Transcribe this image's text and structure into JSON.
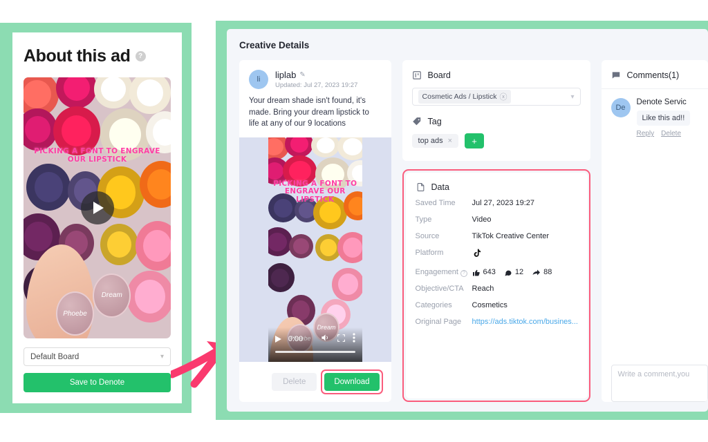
{
  "left_card": {
    "title": "About this ad",
    "help_icon": "question-mark-icon",
    "ad_image": {
      "overlay_text": "PICKING A FONT TO ENGRAVE OUR LIPSTICK",
      "disc_left_label": "Phoebe",
      "disc_right_label": "Dream",
      "play_icon": "play-icon"
    },
    "board_select": {
      "value": "Default Board",
      "caret": "⌄"
    },
    "save_button": "Save to Denote"
  },
  "right_panel": {
    "title": "Creative Details",
    "creative": {
      "avatar_initials": "li",
      "author": "liplab",
      "edit_icon": "pencil-icon",
      "updated": "Updated: Jul 27, 2023 19:27",
      "ad_copy": "Your dream shade isn't found, it's made. Bring your dream lipstick to life at any of our 9 locations",
      "video": {
        "overlay_text": "PICKING A FONT TO ENGRAVE OUR LIPSTICK",
        "disc_left_label": "Phoebe",
        "disc_right_label": "Dream",
        "play_icon": "play-icon",
        "current_time": "0:00",
        "volume_icon": "volume-icon",
        "fullscreen_icon": "fullscreen-icon",
        "more_icon": "kebab-menu-icon"
      },
      "delete_button": "Delete",
      "download_button": "Download"
    },
    "board": {
      "icon": "board-icon",
      "heading": "Board",
      "selected_value": "Cosmetic Ads / Lipstick",
      "remove_icon": "remove-circle-icon",
      "caret": "⌄",
      "tag_icon": "tag-icon",
      "tag_heading": "Tag",
      "tags": [
        {
          "label": "top ads",
          "remove": "×"
        }
      ],
      "add_tag_button": "+"
    },
    "data": {
      "icon": "document-icon",
      "heading": "Data",
      "rows": [
        {
          "label": "Saved Time",
          "value": "Jul 27, 2023 19:27"
        },
        {
          "label": "Type",
          "value": "Video"
        },
        {
          "label": "Source",
          "value": "TikTok Creative Center"
        },
        {
          "label": "Platform",
          "value": "tiktok-icon"
        },
        {
          "label": "Engagement",
          "value": ""
        },
        {
          "label": "Objective/CTA",
          "value": "Reach"
        },
        {
          "label": "Categories",
          "value": "Cosmetics"
        },
        {
          "label": "Original Page",
          "value": "https://ads.tiktok.com/busines..."
        }
      ],
      "engagement": {
        "likes": "643",
        "comments": "12",
        "shares": "88"
      },
      "engagement_help_icon": "question-mark-icon"
    },
    "comments": {
      "icon": "comment-icon",
      "heading": "Comments(1)",
      "items": [
        {
          "avatar_initials": "De",
          "author": "Denote Servic",
          "text": "Like this ad!!",
          "reply": "Reply",
          "delete": "Delete"
        }
      ],
      "input_placeholder": "Write a comment,you"
    }
  },
  "annotations": {
    "arrow": "pink-arrow-annotation",
    "highlight_color": "#FA5C7C",
    "frame_color": "#8CDCB2",
    "accent_green": "#23C16B"
  }
}
